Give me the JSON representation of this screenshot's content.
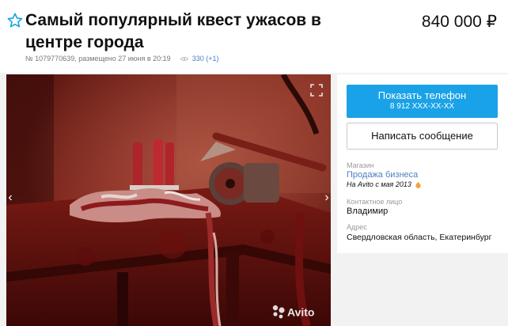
{
  "listing": {
    "title": "Самый популярный квест ужасов в центре города",
    "price": "840 000 ₽",
    "number": "№ 1079770639, размещено 27 июня в 20:19",
    "views": "330 (+1)"
  },
  "gallery": {
    "watermark": "Avito"
  },
  "contact": {
    "phone_button_label": "Показать телефон",
    "phone_masked": "8 912 XXX-XX-XX",
    "message_button_label": "Написать сообщение"
  },
  "seller": {
    "shop_label": "Магазин",
    "shop_name": "Продажа бизнеса",
    "since": "На Avito с мая 2013",
    "contact_label": "Контактное лицо",
    "contact_name": "Владимир",
    "address_label": "Адрес",
    "address": "Свердловская область, Екатеринбург"
  },
  "colors": {
    "primary_button": "#1aa2e8",
    "link": "#4a7fc4"
  }
}
